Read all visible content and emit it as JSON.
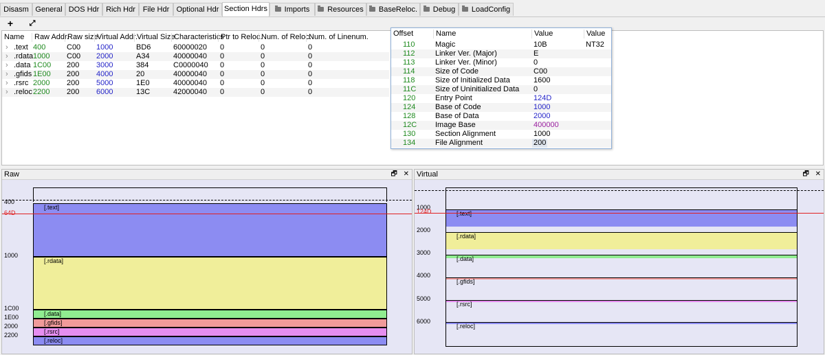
{
  "tabs": [
    {
      "label": "Disasm",
      "folder": false
    },
    {
      "label": "General",
      "folder": false
    },
    {
      "label": "DOS Hdr",
      "folder": false
    },
    {
      "label": "Rich Hdr",
      "folder": false
    },
    {
      "label": "File Hdr",
      "folder": false
    },
    {
      "label": "Optional Hdr",
      "folder": false
    },
    {
      "label": "Section Hdrs",
      "folder": false,
      "active": true
    },
    {
      "label": "Imports",
      "folder": true
    },
    {
      "label": "Resources",
      "folder": true
    },
    {
      "label": "BaseReloc.",
      "folder": true
    },
    {
      "label": "Debug",
      "folder": true
    },
    {
      "label": "LoadConfig",
      "folder": true
    }
  ],
  "toolbar": {
    "add_label": "+",
    "expand_label": "⤢"
  },
  "sections_table": {
    "headers": [
      "Name",
      "Raw Addr.",
      "Raw size",
      "Virtual Addr.",
      "Virtual Size",
      "Characteristics",
      "Ptr to Reloc.",
      "Num. of Reloc.",
      "Num. of Linenum."
    ],
    "rows": [
      {
        "name": ".text",
        "raw_addr": "400",
        "raw_size": "C00",
        "virt_addr": "1000",
        "virt_size": "BD6",
        "chars": "60000020",
        "ptr_reloc": "0",
        "num_reloc": "0",
        "num_lines": "0"
      },
      {
        "name": ".rdata",
        "raw_addr": "1000",
        "raw_size": "C00",
        "virt_addr": "2000",
        "virt_size": "A34",
        "chars": "40000040",
        "ptr_reloc": "0",
        "num_reloc": "0",
        "num_lines": "0"
      },
      {
        "name": ".data",
        "raw_addr": "1C00",
        "raw_size": "200",
        "virt_addr": "3000",
        "virt_size": "384",
        "chars": "C0000040",
        "ptr_reloc": "0",
        "num_reloc": "0",
        "num_lines": "0"
      },
      {
        "name": ".gfids",
        "raw_addr": "1E00",
        "raw_size": "200",
        "virt_addr": "4000",
        "virt_size": "20",
        "chars": "40000040",
        "ptr_reloc": "0",
        "num_reloc": "0",
        "num_lines": "0"
      },
      {
        "name": ".rsrc",
        "raw_addr": "2000",
        "raw_size": "200",
        "virt_addr": "5000",
        "virt_size": "1E0",
        "chars": "40000040",
        "ptr_reloc": "0",
        "num_reloc": "0",
        "num_lines": "0"
      },
      {
        "name": ".reloc",
        "raw_addr": "2200",
        "raw_size": "200",
        "virt_addr": "6000",
        "virt_size": "13C",
        "chars": "42000040",
        "ptr_reloc": "0",
        "num_reloc": "0",
        "num_lines": "0"
      }
    ]
  },
  "popup": {
    "headers": [
      "Offset",
      "Name",
      "Value",
      "Value"
    ],
    "rows": [
      {
        "offset": "110",
        "name": "Magic",
        "value": "10B",
        "value2": "NT32",
        "vcolor": "black"
      },
      {
        "offset": "112",
        "name": "Linker Ver. (Major)",
        "value": "E",
        "value2": "",
        "vcolor": "black"
      },
      {
        "offset": "113",
        "name": "Linker Ver. (Minor)",
        "value": "0",
        "value2": "",
        "vcolor": "black"
      },
      {
        "offset": "114",
        "name": "Size of Code",
        "value": "C00",
        "value2": "",
        "vcolor": "black"
      },
      {
        "offset": "118",
        "name": "Size of Initialized Data",
        "value": "1600",
        "value2": "",
        "vcolor": "black"
      },
      {
        "offset": "11C",
        "name": "Size of Uninitialized Data",
        "value": "0",
        "value2": "",
        "vcolor": "black"
      },
      {
        "offset": "120",
        "name": "Entry Point",
        "value": "124D",
        "value2": "",
        "vcolor": "blue"
      },
      {
        "offset": "124",
        "name": "Base of Code",
        "value": "1000",
        "value2": "",
        "vcolor": "blue"
      },
      {
        "offset": "128",
        "name": "Base of Data",
        "value": "2000",
        "value2": "",
        "vcolor": "blue"
      },
      {
        "offset": "12C",
        "name": "Image Base",
        "value": "400000",
        "value2": "",
        "vcolor": "purple"
      },
      {
        "offset": "130",
        "name": "Section Alignment",
        "value": "1000",
        "value2": "",
        "vcolor": "black"
      },
      {
        "offset": "134",
        "name": "File Alignment",
        "value": "200",
        "value2": "",
        "vcolor": "black"
      }
    ]
  },
  "raw_panel": {
    "title": "Raw",
    "entry_label": "64D",
    "axis_labels": [
      "400",
      "1000",
      "1C00",
      "1E00",
      "2000",
      "2200"
    ],
    "sections": [
      {
        "label": "[.text]",
        "color": "#8c8cf2"
      },
      {
        "label": "[.rdata]",
        "color": "#f0ee9a"
      },
      {
        "label": "[.data]",
        "color": "#90ec90"
      },
      {
        "label": "[.gfids]",
        "color": "#f09a9a"
      },
      {
        "label": "[.rsrc]",
        "color": "#e58ef0"
      },
      {
        "label": "[.reloc]",
        "color": "#8c8cf2"
      }
    ]
  },
  "virtual_panel": {
    "title": "Virtual",
    "entry_label": "124D",
    "axis_labels": [
      "1000",
      "2000",
      "3000",
      "4000",
      "5000",
      "6000"
    ],
    "sections": [
      {
        "label": "[.text]",
        "color": "#8c8cf2"
      },
      {
        "label": "[.rdata]",
        "color": "#f0ee9a"
      },
      {
        "label": "[.data]",
        "color": "#90ec90"
      },
      {
        "label": "[.gfids]",
        "color": "#f09a9a"
      },
      {
        "label": "[.rsrc]",
        "color": "#e58ef0"
      },
      {
        "label": "[.reloc]",
        "color": "#8c8cf2"
      }
    ]
  },
  "panel_icons": {
    "restore": "🗗",
    "close": "✕"
  }
}
